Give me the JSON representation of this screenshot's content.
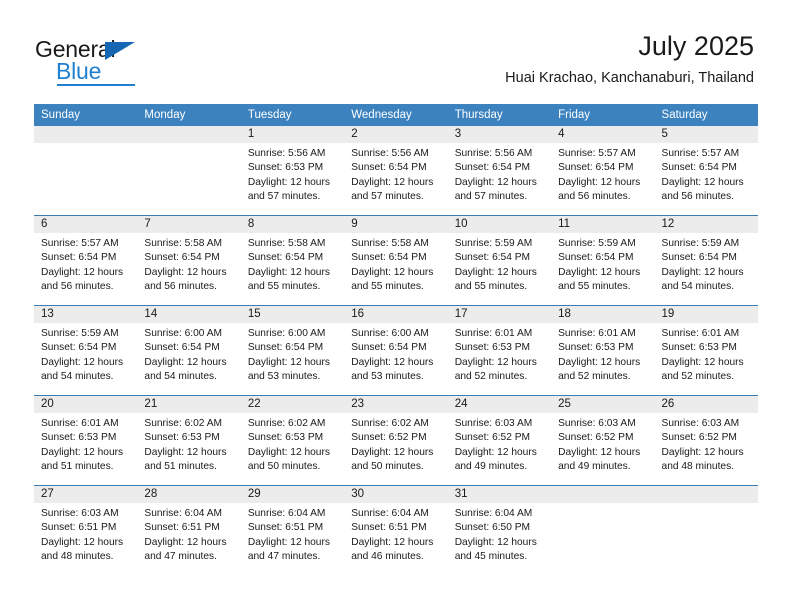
{
  "brand": {
    "name_dark": "General",
    "name_light": "Blue",
    "accent_color": "#1f7fd0",
    "triangle_color": "#1567b3"
  },
  "header": {
    "title": "July 2025",
    "subtitle": "Huai Krachao, Kanchanaburi, Thailand"
  },
  "calendar": {
    "header_bg": "#3b82bf",
    "daynum_bg": "#ececec",
    "weekdays": [
      "Sunday",
      "Monday",
      "Tuesday",
      "Wednesday",
      "Thursday",
      "Friday",
      "Saturday"
    ],
    "weeks": [
      {
        "days": [
          {
            "num": "",
            "lines": []
          },
          {
            "num": "",
            "lines": []
          },
          {
            "num": "1",
            "lines": [
              "Sunrise: 5:56 AM",
              "Sunset: 6:53 PM",
              "Daylight: 12 hours",
              "and 57 minutes."
            ]
          },
          {
            "num": "2",
            "lines": [
              "Sunrise: 5:56 AM",
              "Sunset: 6:54 PM",
              "Daylight: 12 hours",
              "and 57 minutes."
            ]
          },
          {
            "num": "3",
            "lines": [
              "Sunrise: 5:56 AM",
              "Sunset: 6:54 PM",
              "Daylight: 12 hours",
              "and 57 minutes."
            ]
          },
          {
            "num": "4",
            "lines": [
              "Sunrise: 5:57 AM",
              "Sunset: 6:54 PM",
              "Daylight: 12 hours",
              "and 56 minutes."
            ]
          },
          {
            "num": "5",
            "lines": [
              "Sunrise: 5:57 AM",
              "Sunset: 6:54 PM",
              "Daylight: 12 hours",
              "and 56 minutes."
            ]
          }
        ]
      },
      {
        "days": [
          {
            "num": "6",
            "lines": [
              "Sunrise: 5:57 AM",
              "Sunset: 6:54 PM",
              "Daylight: 12 hours",
              "and 56 minutes."
            ]
          },
          {
            "num": "7",
            "lines": [
              "Sunrise: 5:58 AM",
              "Sunset: 6:54 PM",
              "Daylight: 12 hours",
              "and 56 minutes."
            ]
          },
          {
            "num": "8",
            "lines": [
              "Sunrise: 5:58 AM",
              "Sunset: 6:54 PM",
              "Daylight: 12 hours",
              "and 55 minutes."
            ]
          },
          {
            "num": "9",
            "lines": [
              "Sunrise: 5:58 AM",
              "Sunset: 6:54 PM",
              "Daylight: 12 hours",
              "and 55 minutes."
            ]
          },
          {
            "num": "10",
            "lines": [
              "Sunrise: 5:59 AM",
              "Sunset: 6:54 PM",
              "Daylight: 12 hours",
              "and 55 minutes."
            ]
          },
          {
            "num": "11",
            "lines": [
              "Sunrise: 5:59 AM",
              "Sunset: 6:54 PM",
              "Daylight: 12 hours",
              "and 55 minutes."
            ]
          },
          {
            "num": "12",
            "lines": [
              "Sunrise: 5:59 AM",
              "Sunset: 6:54 PM",
              "Daylight: 12 hours",
              "and 54 minutes."
            ]
          }
        ]
      },
      {
        "days": [
          {
            "num": "13",
            "lines": [
              "Sunrise: 5:59 AM",
              "Sunset: 6:54 PM",
              "Daylight: 12 hours",
              "and 54 minutes."
            ]
          },
          {
            "num": "14",
            "lines": [
              "Sunrise: 6:00 AM",
              "Sunset: 6:54 PM",
              "Daylight: 12 hours",
              "and 54 minutes."
            ]
          },
          {
            "num": "15",
            "lines": [
              "Sunrise: 6:00 AM",
              "Sunset: 6:54 PM",
              "Daylight: 12 hours",
              "and 53 minutes."
            ]
          },
          {
            "num": "16",
            "lines": [
              "Sunrise: 6:00 AM",
              "Sunset: 6:54 PM",
              "Daylight: 12 hours",
              "and 53 minutes."
            ]
          },
          {
            "num": "17",
            "lines": [
              "Sunrise: 6:01 AM",
              "Sunset: 6:53 PM",
              "Daylight: 12 hours",
              "and 52 minutes."
            ]
          },
          {
            "num": "18",
            "lines": [
              "Sunrise: 6:01 AM",
              "Sunset: 6:53 PM",
              "Daylight: 12 hours",
              "and 52 minutes."
            ]
          },
          {
            "num": "19",
            "lines": [
              "Sunrise: 6:01 AM",
              "Sunset: 6:53 PM",
              "Daylight: 12 hours",
              "and 52 minutes."
            ]
          }
        ]
      },
      {
        "days": [
          {
            "num": "20",
            "lines": [
              "Sunrise: 6:01 AM",
              "Sunset: 6:53 PM",
              "Daylight: 12 hours",
              "and 51 minutes."
            ]
          },
          {
            "num": "21",
            "lines": [
              "Sunrise: 6:02 AM",
              "Sunset: 6:53 PM",
              "Daylight: 12 hours",
              "and 51 minutes."
            ]
          },
          {
            "num": "22",
            "lines": [
              "Sunrise: 6:02 AM",
              "Sunset: 6:53 PM",
              "Daylight: 12 hours",
              "and 50 minutes."
            ]
          },
          {
            "num": "23",
            "lines": [
              "Sunrise: 6:02 AM",
              "Sunset: 6:52 PM",
              "Daylight: 12 hours",
              "and 50 minutes."
            ]
          },
          {
            "num": "24",
            "lines": [
              "Sunrise: 6:03 AM",
              "Sunset: 6:52 PM",
              "Daylight: 12 hours",
              "and 49 minutes."
            ]
          },
          {
            "num": "25",
            "lines": [
              "Sunrise: 6:03 AM",
              "Sunset: 6:52 PM",
              "Daylight: 12 hours",
              "and 49 minutes."
            ]
          },
          {
            "num": "26",
            "lines": [
              "Sunrise: 6:03 AM",
              "Sunset: 6:52 PM",
              "Daylight: 12 hours",
              "and 48 minutes."
            ]
          }
        ]
      },
      {
        "days": [
          {
            "num": "27",
            "lines": [
              "Sunrise: 6:03 AM",
              "Sunset: 6:51 PM",
              "Daylight: 12 hours",
              "and 48 minutes."
            ]
          },
          {
            "num": "28",
            "lines": [
              "Sunrise: 6:04 AM",
              "Sunset: 6:51 PM",
              "Daylight: 12 hours",
              "and 47 minutes."
            ]
          },
          {
            "num": "29",
            "lines": [
              "Sunrise: 6:04 AM",
              "Sunset: 6:51 PM",
              "Daylight: 12 hours",
              "and 47 minutes."
            ]
          },
          {
            "num": "30",
            "lines": [
              "Sunrise: 6:04 AM",
              "Sunset: 6:51 PM",
              "Daylight: 12 hours",
              "and 46 minutes."
            ]
          },
          {
            "num": "31",
            "lines": [
              "Sunrise: 6:04 AM",
              "Sunset: 6:50 PM",
              "Daylight: 12 hours",
              "and 45 minutes."
            ]
          },
          {
            "num": "",
            "lines": []
          },
          {
            "num": "",
            "lines": []
          }
        ]
      }
    ]
  }
}
